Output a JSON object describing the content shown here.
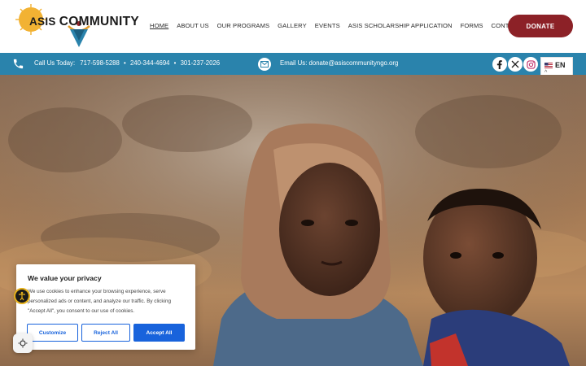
{
  "logo": {
    "text_asis": "ASIS",
    "text_community": "COMMUNITY"
  },
  "nav": {
    "items": [
      {
        "label": "HOME",
        "active": true
      },
      {
        "label": "ABOUT US"
      },
      {
        "label": "OUR PROGRAMS"
      },
      {
        "label": "GALLERY"
      },
      {
        "label": "EVENTS"
      },
      {
        "label": "ASIS SCHOLARSHIP APPLICATION"
      },
      {
        "label": "FORMS"
      },
      {
        "label": "CONTACT US"
      }
    ],
    "donate_label": "DONATE"
  },
  "infobar": {
    "call_label": "Call Us Today:",
    "phones": [
      "717-598-5288",
      "240-344-4694",
      "301-237-2026"
    ],
    "email_label": "Email Us:",
    "email": "donate@asiscommunityngo.org",
    "social": [
      "facebook-icon",
      "x-icon",
      "instagram-icon"
    ]
  },
  "language": {
    "code": "EN",
    "caret": "^"
  },
  "cookie": {
    "title": "We value your privacy",
    "text": "We use cookies to enhance your browsing experience, serve personalized ads or content, and analyze our traffic. By clicking \"Accept All\", you consent to our use of cookies.",
    "customize_label": "Customize",
    "reject_label": "Reject All",
    "accept_label": "Accept All"
  },
  "colors": {
    "accent_blue": "#2a83ac",
    "donate_red": "#8c2127",
    "cookie_blue": "#1863dc"
  }
}
